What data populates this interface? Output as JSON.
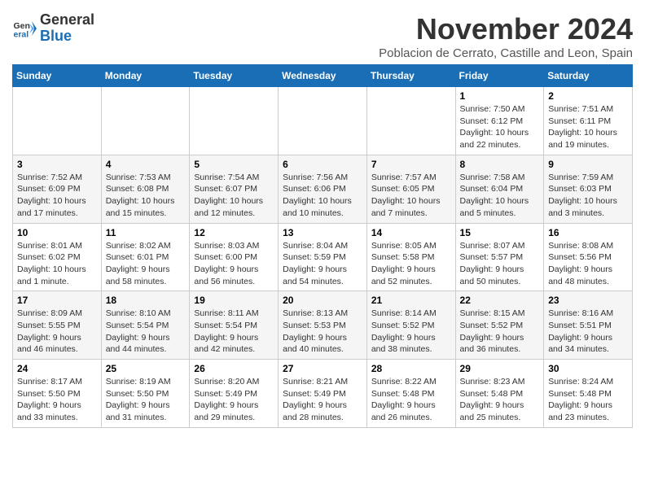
{
  "logo": {
    "general": "General",
    "blue": "Blue"
  },
  "header": {
    "month": "November 2024",
    "location": "Poblacion de Cerrato, Castille and Leon, Spain"
  },
  "weekdays": [
    "Sunday",
    "Monday",
    "Tuesday",
    "Wednesday",
    "Thursday",
    "Friday",
    "Saturday"
  ],
  "weeks": [
    [
      {
        "day": "",
        "info": ""
      },
      {
        "day": "",
        "info": ""
      },
      {
        "day": "",
        "info": ""
      },
      {
        "day": "",
        "info": ""
      },
      {
        "day": "",
        "info": ""
      },
      {
        "day": "1",
        "info": "Sunrise: 7:50 AM\nSunset: 6:12 PM\nDaylight: 10 hours and 22 minutes."
      },
      {
        "day": "2",
        "info": "Sunrise: 7:51 AM\nSunset: 6:11 PM\nDaylight: 10 hours and 19 minutes."
      }
    ],
    [
      {
        "day": "3",
        "info": "Sunrise: 7:52 AM\nSunset: 6:09 PM\nDaylight: 10 hours and 17 minutes."
      },
      {
        "day": "4",
        "info": "Sunrise: 7:53 AM\nSunset: 6:08 PM\nDaylight: 10 hours and 15 minutes."
      },
      {
        "day": "5",
        "info": "Sunrise: 7:54 AM\nSunset: 6:07 PM\nDaylight: 10 hours and 12 minutes."
      },
      {
        "day": "6",
        "info": "Sunrise: 7:56 AM\nSunset: 6:06 PM\nDaylight: 10 hours and 10 minutes."
      },
      {
        "day": "7",
        "info": "Sunrise: 7:57 AM\nSunset: 6:05 PM\nDaylight: 10 hours and 7 minutes."
      },
      {
        "day": "8",
        "info": "Sunrise: 7:58 AM\nSunset: 6:04 PM\nDaylight: 10 hours and 5 minutes."
      },
      {
        "day": "9",
        "info": "Sunrise: 7:59 AM\nSunset: 6:03 PM\nDaylight: 10 hours and 3 minutes."
      }
    ],
    [
      {
        "day": "10",
        "info": "Sunrise: 8:01 AM\nSunset: 6:02 PM\nDaylight: 10 hours and 1 minute."
      },
      {
        "day": "11",
        "info": "Sunrise: 8:02 AM\nSunset: 6:01 PM\nDaylight: 9 hours and 58 minutes."
      },
      {
        "day": "12",
        "info": "Sunrise: 8:03 AM\nSunset: 6:00 PM\nDaylight: 9 hours and 56 minutes."
      },
      {
        "day": "13",
        "info": "Sunrise: 8:04 AM\nSunset: 5:59 PM\nDaylight: 9 hours and 54 minutes."
      },
      {
        "day": "14",
        "info": "Sunrise: 8:05 AM\nSunset: 5:58 PM\nDaylight: 9 hours and 52 minutes."
      },
      {
        "day": "15",
        "info": "Sunrise: 8:07 AM\nSunset: 5:57 PM\nDaylight: 9 hours and 50 minutes."
      },
      {
        "day": "16",
        "info": "Sunrise: 8:08 AM\nSunset: 5:56 PM\nDaylight: 9 hours and 48 minutes."
      }
    ],
    [
      {
        "day": "17",
        "info": "Sunrise: 8:09 AM\nSunset: 5:55 PM\nDaylight: 9 hours and 46 minutes."
      },
      {
        "day": "18",
        "info": "Sunrise: 8:10 AM\nSunset: 5:54 PM\nDaylight: 9 hours and 44 minutes."
      },
      {
        "day": "19",
        "info": "Sunrise: 8:11 AM\nSunset: 5:54 PM\nDaylight: 9 hours and 42 minutes."
      },
      {
        "day": "20",
        "info": "Sunrise: 8:13 AM\nSunset: 5:53 PM\nDaylight: 9 hours and 40 minutes."
      },
      {
        "day": "21",
        "info": "Sunrise: 8:14 AM\nSunset: 5:52 PM\nDaylight: 9 hours and 38 minutes."
      },
      {
        "day": "22",
        "info": "Sunrise: 8:15 AM\nSunset: 5:52 PM\nDaylight: 9 hours and 36 minutes."
      },
      {
        "day": "23",
        "info": "Sunrise: 8:16 AM\nSunset: 5:51 PM\nDaylight: 9 hours and 34 minutes."
      }
    ],
    [
      {
        "day": "24",
        "info": "Sunrise: 8:17 AM\nSunset: 5:50 PM\nDaylight: 9 hours and 33 minutes."
      },
      {
        "day": "25",
        "info": "Sunrise: 8:19 AM\nSunset: 5:50 PM\nDaylight: 9 hours and 31 minutes."
      },
      {
        "day": "26",
        "info": "Sunrise: 8:20 AM\nSunset: 5:49 PM\nDaylight: 9 hours and 29 minutes."
      },
      {
        "day": "27",
        "info": "Sunrise: 8:21 AM\nSunset: 5:49 PM\nDaylight: 9 hours and 28 minutes."
      },
      {
        "day": "28",
        "info": "Sunrise: 8:22 AM\nSunset: 5:48 PM\nDaylight: 9 hours and 26 minutes."
      },
      {
        "day": "29",
        "info": "Sunrise: 8:23 AM\nSunset: 5:48 PM\nDaylight: 9 hours and 25 minutes."
      },
      {
        "day": "30",
        "info": "Sunrise: 8:24 AM\nSunset: 5:48 PM\nDaylight: 9 hours and 23 minutes."
      }
    ]
  ]
}
